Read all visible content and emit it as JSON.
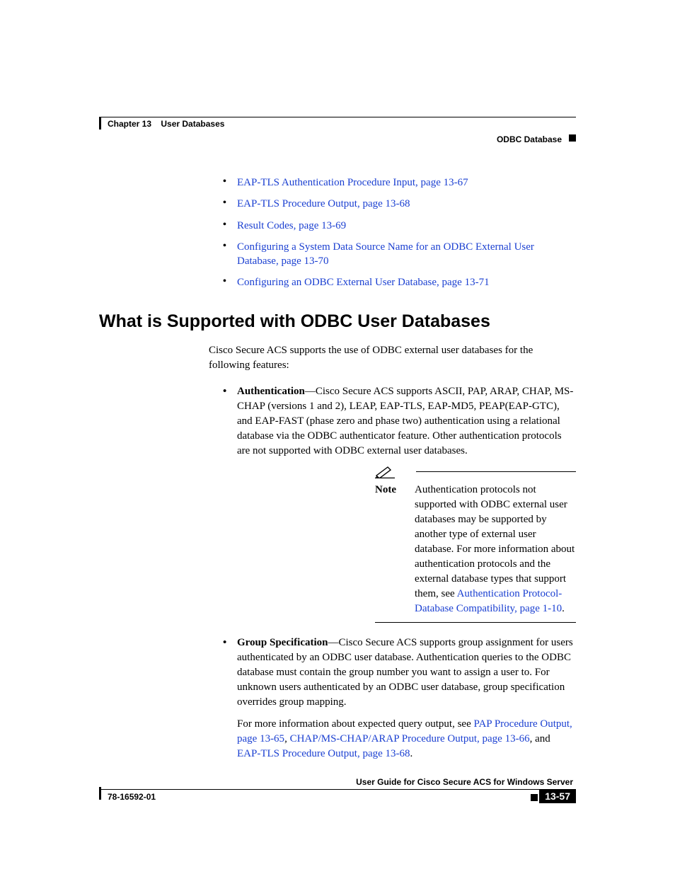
{
  "header": {
    "chapter_label": "Chapter 13",
    "chapter_title": "User Databases",
    "section": "ODBC Database"
  },
  "top_links": [
    "EAP-TLS Authentication Procedure Input, page 13-67",
    "EAP-TLS Procedure Output, page 13-68",
    "Result Codes, page 13-69",
    "Configuring a System Data Source Name for an ODBC External User Database, page 13-70",
    "Configuring an ODBC External User Database, page 13-71"
  ],
  "heading": "What is Supported with ODBC User Databases",
  "intro": "Cisco Secure ACS supports the use of ODBC external user databases for the following features:",
  "auth_item": {
    "label": "Authentication",
    "text": "—Cisco Secure ACS supports ASCII, PAP, ARAP, CHAP, MS-CHAP (versions 1 and 2), LEAP, EAP-TLS, EAP-MD5, PEAP(EAP-GTC), and EAP-FAST (phase zero and phase two) authentication using a relational database via the ODBC authenticator feature. Other authentication protocols are not supported with ODBC external user databases."
  },
  "note": {
    "label": "Note",
    "pre": "Authentication protocols not supported with ODBC external user databases may be supported by another type of external user database. For more information about authentication protocols and the external database types that support them, see ",
    "link": "Authentication Protocol-Database Compatibility, page 1-10",
    "post": "."
  },
  "group_item": {
    "label": "Group Specification",
    "text": "—Cisco Secure ACS supports group assignment for users authenticated by an ODBC user database. Authentication queries to the ODBC database must contain the group number you want to assign a user to. For unknown users authenticated by an ODBC user database, group specification overrides group mapping.",
    "para2_pre": "For more information about expected query output, see ",
    "link1": "PAP Procedure Output, page 13-65",
    "sep1": ", ",
    "link2": "CHAP/MS-CHAP/ARAP Procedure Output, page 13-66",
    "sep2": ", and ",
    "link3": "EAP-TLS Procedure Output, page 13-68",
    "post": "."
  },
  "footer": {
    "title": "User Guide for Cisco Secure ACS for Windows Server",
    "doc_number": "78-16592-01",
    "page": "13-57"
  }
}
